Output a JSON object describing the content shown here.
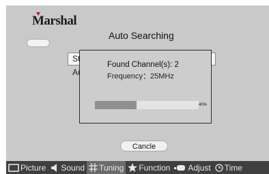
{
  "brand": {
    "logo_text": "Marshal"
  },
  "screen": {
    "title": "Auto Searching",
    "background_field_text": "St",
    "background_label": "Au"
  },
  "dialog": {
    "found_label": "Found Channel(s): 2",
    "frequency_label": "Frequency：25MHz",
    "progress": {
      "value": 0.4,
      "label": "40%"
    }
  },
  "cancel_button": "Cancle",
  "menu": {
    "items": [
      {
        "label": "Picture",
        "icon": "monitor-icon",
        "active": false
      },
      {
        "label": "Sound",
        "icon": "speaker-icon",
        "active": false
      },
      {
        "label": "Tuning",
        "icon": "grid-icon",
        "active": true
      },
      {
        "label": "Function",
        "icon": "star-icon",
        "active": false
      },
      {
        "label": "Adjust",
        "icon": "adjust-icon",
        "active": false
      },
      {
        "label": "Time",
        "icon": "clock-icon",
        "active": false
      }
    ]
  },
  "colors": {
    "logo_accent": "#c8102e",
    "menu_bg": "#3f3f3f",
    "menu_active": "#6b6b6b",
    "screen_bg": "#c9c9c9"
  }
}
